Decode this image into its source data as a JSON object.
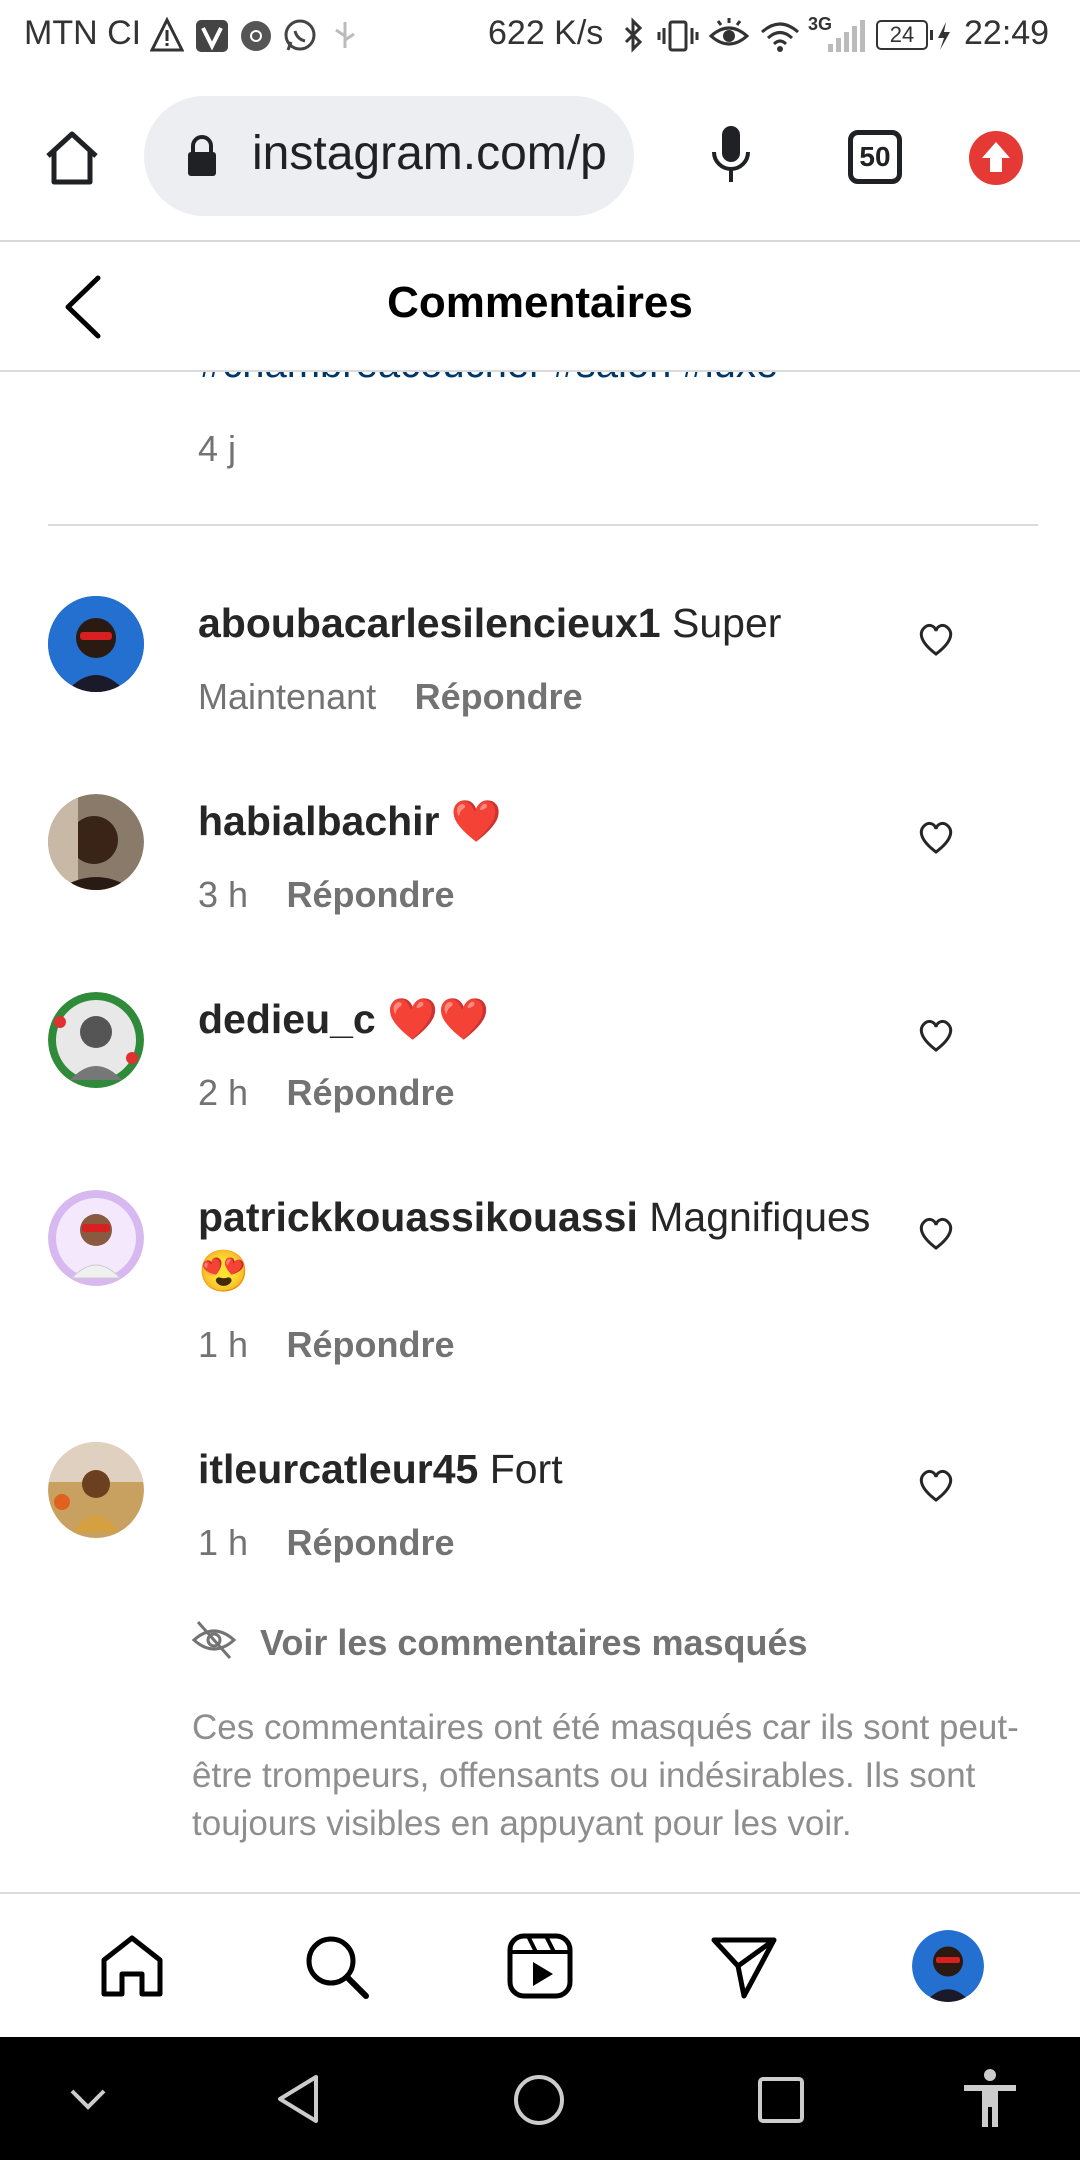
{
  "status_bar": {
    "carrier": "MTN CI",
    "speed": "622 K/s",
    "network": "3G",
    "battery": "24",
    "time": "22:49"
  },
  "browser": {
    "url": "instagram.com/p",
    "tab_count": "50"
  },
  "header": {
    "title": "Commentaires"
  },
  "caption": {
    "hashtags": "#chambreacoucher #salon #luxe",
    "time": "4 j"
  },
  "comments": [
    {
      "username": "aboubacarlesilencieux1",
      "text": "Super",
      "time": "Maintenant",
      "reply_label": "Répondre"
    },
    {
      "username": "habialbachir",
      "text": "❤️",
      "time": "3 h",
      "reply_label": "Répondre"
    },
    {
      "username": "dedieu_c",
      "text": "❤️❤️",
      "time": "2 h",
      "reply_label": "Répondre"
    },
    {
      "username": "patrickkouassikouassi",
      "text": "Magnifiques",
      "text_line2": "😍",
      "time": "1 h",
      "reply_label": "Répondre"
    },
    {
      "username": "itleurcatleur45",
      "text": "Fort",
      "time": "1 h",
      "reply_label": "Répondre"
    }
  ],
  "hidden_comments": {
    "link_label": "Voir les commentaires masqués",
    "notice": "Ces commentaires ont été masqués car ils sont peut-être trompeurs, offensants ou indésirables. Ils sont toujours visibles en appuyant pour les voir."
  },
  "colors": {
    "hashtag": "#00376b",
    "secondary_text": "#737373",
    "update_button": "#e53935",
    "url_pill": "#eceef2"
  },
  "icons": [
    "home-icon",
    "lock-icon",
    "microphone-icon",
    "tab-switcher-icon",
    "update-icon",
    "back-arrow-icon",
    "heart-icon",
    "eye-slash-icon",
    "search-icon",
    "reels-icon",
    "direct-message-icon",
    "profile-avatar"
  ]
}
